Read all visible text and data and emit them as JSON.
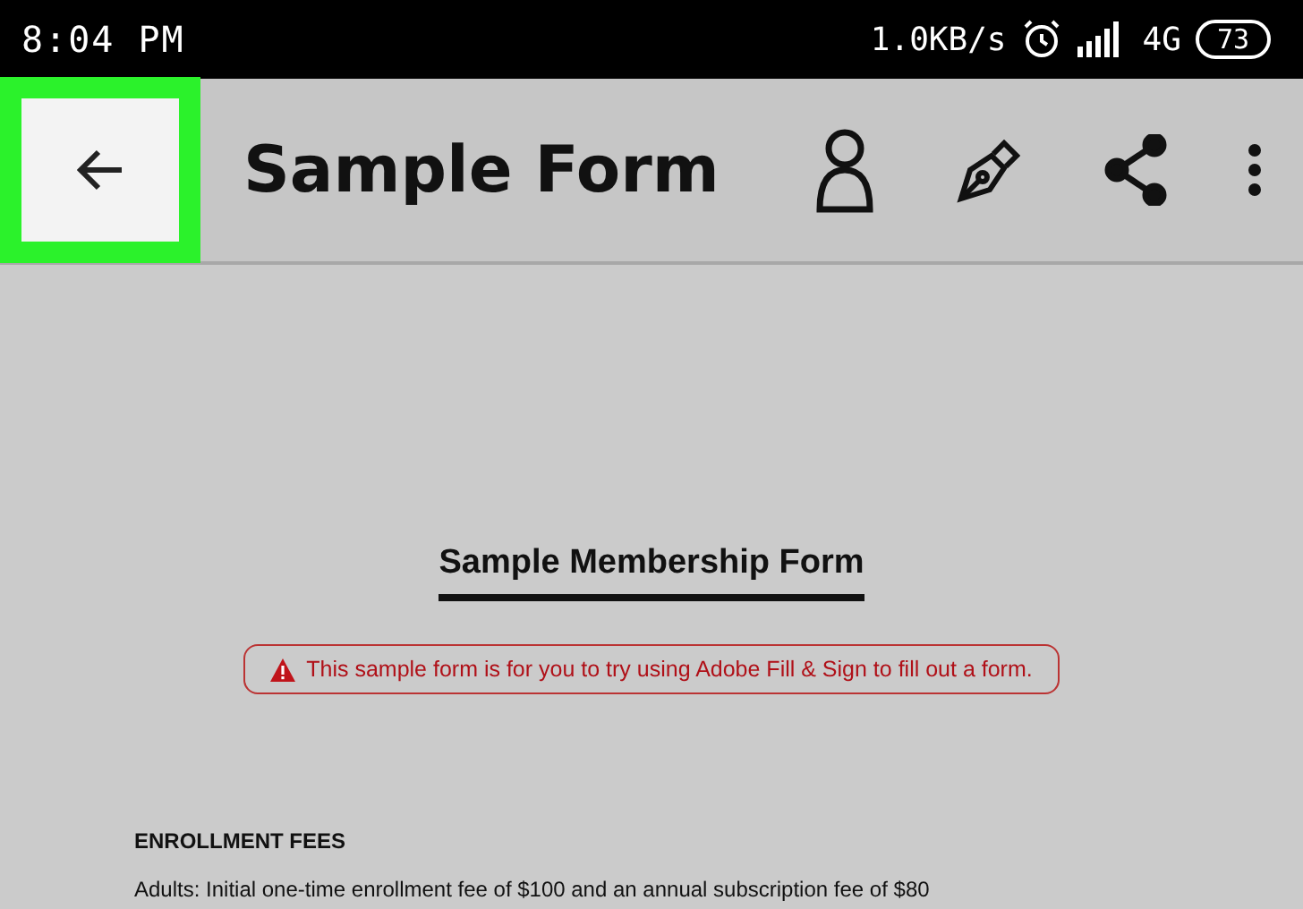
{
  "status_bar": {
    "time": "8:04 PM",
    "network_speed": "1.0KB/s",
    "network_type": "4G",
    "battery": "73"
  },
  "toolbar": {
    "back_button": {
      "highlighted": true
    },
    "title": "Sample Form"
  },
  "document": {
    "title": "Sample Membership Form",
    "notice": "This sample form is for you to try using Adobe Fill & Sign to fill out a form.",
    "sections": [
      {
        "heading": "ENROLLMENT FEES",
        "text": "Adults: Initial one-time enrollment fee of $100 and an annual subscription fee of $80"
      }
    ]
  }
}
